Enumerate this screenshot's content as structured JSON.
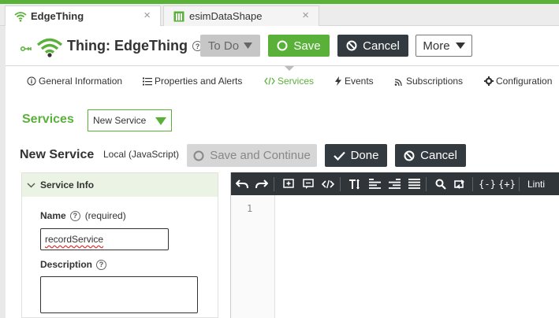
{
  "tabs": [
    {
      "label": "EdgeThing",
      "icon": "wifi-icon",
      "close": "×",
      "active": true
    },
    {
      "label": "esimDataShape",
      "icon": "datashape-icon",
      "close": "×",
      "active": false
    }
  ],
  "header": {
    "title": "Thing: EdgeThing",
    "help": "?",
    "todo_label": "To Do",
    "save_label": "Save",
    "cancel_label": "Cancel",
    "more_label": "More"
  },
  "subnav": {
    "items": [
      {
        "label": "General Information",
        "icon": "info-icon"
      },
      {
        "label": "Properties and Alerts",
        "icon": "list-icon"
      },
      {
        "label": "Services",
        "icon": "code-icon"
      },
      {
        "label": "Events",
        "icon": "bolt-icon"
      },
      {
        "label": "Subscriptions",
        "icon": "signal-icon"
      },
      {
        "label": "Configuration",
        "icon": "gear-icon"
      }
    ],
    "active": "Services"
  },
  "services": {
    "heading": "Services",
    "select_value": "New Service"
  },
  "service_editor": {
    "title": "New Service",
    "subtitle": "Local (JavaScript)",
    "save_continue_label": "Save and Continue",
    "done_label": "Done",
    "cancel_label": "Cancel"
  },
  "service_info": {
    "heading": "Service Info",
    "name_label": "Name",
    "name_required": "(required)",
    "name_value": "recordService",
    "description_label": "Description",
    "help": "?"
  },
  "code_editor": {
    "line_number": "1",
    "linting_label": "Linti"
  },
  "colors": {
    "accent": "#5ab13a",
    "dark": "#333b40"
  }
}
